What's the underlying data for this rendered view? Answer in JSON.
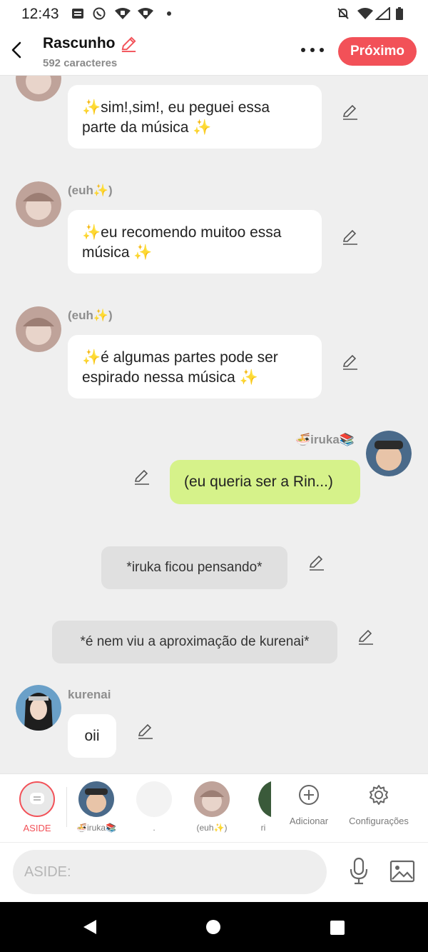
{
  "status_bar": {
    "time": "12:43"
  },
  "header": {
    "title": "Rascunho",
    "subtitle": "592 caracteres",
    "next_label": "Próximo"
  },
  "messages": [
    {
      "name": "",
      "text_line1": "✨sim!,sim!, eu peguei essa",
      "text_line2": "parte da música ✨"
    },
    {
      "name": "(euh✨)",
      "text_line1": "✨eu recomendo muitoo essa",
      "text_line2": "música ✨"
    },
    {
      "name": "(euh✨)",
      "text_line1": "✨é algumas partes pode ser",
      "text_line2": "espirado nessa música ✨"
    },
    {
      "name": "🍜iruka📚",
      "text": "(eu queria ser a Rin...)"
    },
    {
      "narration": "*iruka ficou pensando*"
    },
    {
      "narration": "*é nem viu a aproximação de kurenai*"
    },
    {
      "name": "kurenai",
      "text": "oii"
    }
  ],
  "character_bar": {
    "aside_label": "ASIDE",
    "characters": [
      "🍜iruka📚",
      ".",
      "(euh✨)",
      "ri"
    ],
    "add_label": "Adicionar",
    "settings_label": "Configurações"
  },
  "composer": {
    "placeholder": "ASIDE:"
  },
  "colors": {
    "accent": "#f25158",
    "my_bubble": "#d6f28a",
    "background": "#efefef"
  }
}
